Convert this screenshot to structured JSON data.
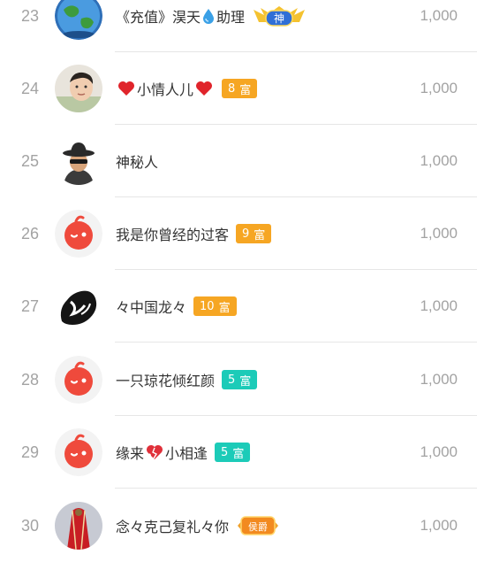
{
  "rows": [
    {
      "rank": "23",
      "name_parts": [
        "《充值》淏天",
        "助理"
      ],
      "inline_icon": "water-drop-icon",
      "badge": {
        "type": "image",
        "label": "神"
      },
      "score": "1,000",
      "avatar": "earth-avatar"
    },
    {
      "rank": "24",
      "name_parts": [
        "",
        "小情人儿",
        ""
      ],
      "inline_icon": "heart-icon",
      "badge": {
        "type": "level",
        "level": "8",
        "label": "富",
        "color": "#f6a623"
      },
      "score": "1,000",
      "avatar": "photo-avatar"
    },
    {
      "rank": "25",
      "name_parts": [
        "神秘人"
      ],
      "badge": null,
      "score": "1,000",
      "avatar": "mystery-avatar"
    },
    {
      "rank": "26",
      "name_parts": [
        "我是你曾经的过客"
      ],
      "badge": {
        "type": "level",
        "level": "9",
        "label": "富",
        "color": "#f6a623"
      },
      "score": "1,000",
      "avatar": "default-avatar"
    },
    {
      "rank": "27",
      "name_parts": [
        "々中国龙々"
      ],
      "badge": {
        "type": "level",
        "level": "10",
        "label": "富",
        "color": "#f6a623"
      },
      "score": "1,000",
      "avatar": "ink-avatar"
    },
    {
      "rank": "28",
      "name_parts": [
        "一只琼花倾红颜"
      ],
      "badge": {
        "type": "level",
        "level": "5",
        "label": "富",
        "color": "#1ccbb8"
      },
      "score": "1,000",
      "avatar": "default-avatar"
    },
    {
      "rank": "29",
      "name_parts": [
        "缘来",
        "小相逢"
      ],
      "inline_icon": "broken-heart-icon",
      "badge": {
        "type": "level",
        "level": "5",
        "label": "富",
        "color": "#1ccbb8"
      },
      "score": "1,000",
      "avatar": "default-avatar"
    },
    {
      "rank": "30",
      "name_parts": [
        "念々克己复礼々你"
      ],
      "badge": {
        "type": "image",
        "label": "侯爵"
      },
      "score": "1,000",
      "avatar": "red-flag-avatar"
    }
  ],
  "colors": {
    "orange": "#f6a623",
    "teal": "#1ccbb8",
    "rank": "#a3a3a3",
    "divider": "#e6e6e6"
  }
}
